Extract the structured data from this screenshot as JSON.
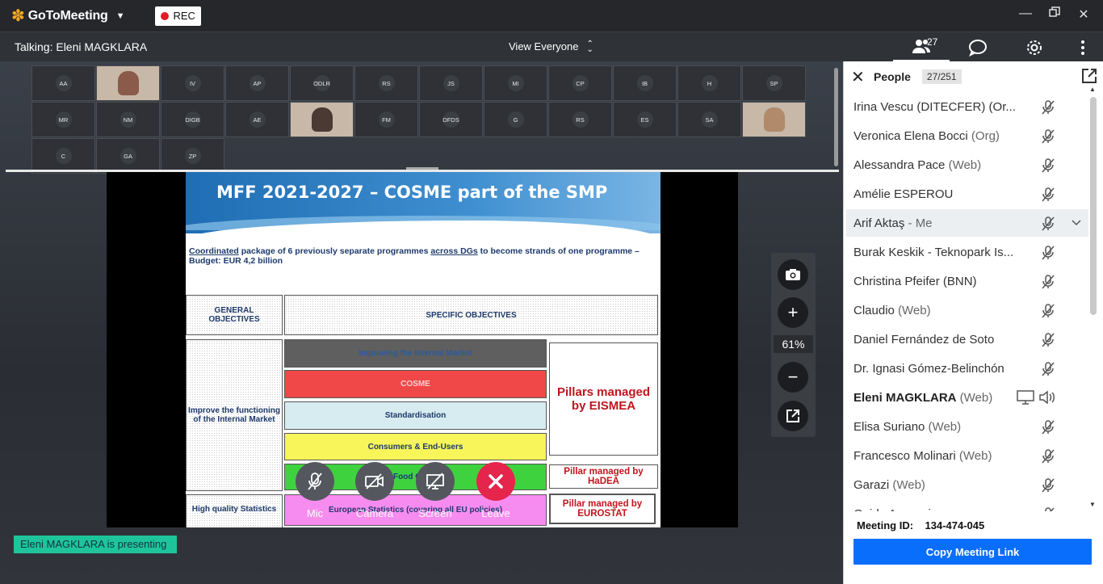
{
  "app": {
    "name": "GoToMeeting",
    "rec_label": "REC",
    "talking": "Talking: Eleni MAGKLARA",
    "view_mode": "View Everyone",
    "participant_count": "27"
  },
  "window_controls": [
    "minimize-icon",
    "restore-icon",
    "close-icon"
  ],
  "thumbnails": [
    {
      "initials": "AA"
    },
    {
      "initials": "",
      "video": true
    },
    {
      "initials": "IV"
    },
    {
      "initials": "AP"
    },
    {
      "initials": "ODLR"
    },
    {
      "initials": "RS"
    },
    {
      "initials": "JS"
    },
    {
      "initials": "MI"
    },
    {
      "initials": "CP"
    },
    {
      "initials": "IB"
    },
    {
      "initials": "H"
    },
    {
      "initials": "SP"
    },
    {
      "initials": "MR"
    },
    {
      "initials": "NM"
    },
    {
      "initials": "DIGB"
    },
    {
      "initials": "AE"
    },
    {
      "initials": "",
      "video": true
    },
    {
      "initials": "FM"
    },
    {
      "initials": "DFDS"
    },
    {
      "initials": "G"
    },
    {
      "initials": "RS"
    },
    {
      "initials": "ES"
    },
    {
      "initials": "SA"
    },
    {
      "initials": "",
      "video": true
    },
    {
      "initials": "C"
    },
    {
      "initials": "GA"
    },
    {
      "initials": "ZP"
    }
  ],
  "slide": {
    "title": "MFF 2021-2027 – COSME part of the SMP",
    "sub_1": "Coordinated",
    "sub_2": " package of 6 previously separate  programmes ",
    "sub_3": "across DGs",
    "sub_4": " to become strands of one programme – Budget: EUR 4,2 billion",
    "general_objectives": "GENERAL OBJECTIVES",
    "specific_objectives": "SPECIFIC OBJECTIVES",
    "improve_functioning": "Improve the functioning of the Internal Market",
    "high_quality": "High quality Statistics",
    "strands": [
      {
        "label": "Improving the Internal Market",
        "bg": "#5f5f5f",
        "fg": "#2b5c9c"
      },
      {
        "label": "COSME",
        "bg": "#f04848",
        "fg": "#f5d0d0"
      },
      {
        "label": "Standardisation",
        "bg": "#d7ecf0",
        "fg": "#1d3a6b"
      },
      {
        "label": "Consumers & End-Users",
        "bg": "#f7f55a",
        "fg": "#1d3a6b"
      },
      {
        "label": "Food Chain",
        "bg": "#3fd23f",
        "fg": "#1d3a6b"
      },
      {
        "label": "European Statistics (covering all EU policies)",
        "bg": "#f78cf0",
        "fg": "#1d3a6b"
      }
    ],
    "pillars_eismea": "Pillars managed by EISMEA",
    "pillar_hadea": "Pillar managed by HaDEA",
    "pillar_eurostat": "Pillar managed by EUROSTAT"
  },
  "zoom": {
    "percent": "61%"
  },
  "presenting": "Eleni MAGKLARA is presenting",
  "controls": [
    {
      "label": "Mic"
    },
    {
      "label": "Camera"
    },
    {
      "label": "Screen"
    },
    {
      "label": "Leave"
    }
  ],
  "people": {
    "title": "People",
    "count": "27/251",
    "list": [
      {
        "name": "Irina Vescu (DITECFER) (Or...",
        "suffix": ""
      },
      {
        "name": "Veronica Elena Bocci",
        "suffix": " (Org)"
      },
      {
        "name": "Alessandra Pace",
        "suffix": " (Web)"
      },
      {
        "name": "Amélie ESPEROU",
        "suffix": ""
      },
      {
        "name": "Arif Aktaş",
        "suffix": " - Me"
      },
      {
        "name": "Burak Keskik - Teknopark Is...",
        "suffix": ""
      },
      {
        "name": "Christina Pfeifer (BNN)",
        "suffix": ""
      },
      {
        "name": "Claudio",
        "suffix": " (Web)"
      },
      {
        "name": "Daniel Fernández de Soto",
        "suffix": ""
      },
      {
        "name": "Dr. Ignasi Gómez-Belinchón",
        "suffix": ""
      },
      {
        "name": "Eleni MAGKLARA",
        "suffix": " (Web)"
      },
      {
        "name": "Elisa Suriano",
        "suffix": " (Web)"
      },
      {
        "name": "Francesco Molinari",
        "suffix": " (Web)"
      },
      {
        "name": "Garazi",
        "suffix": " (Web)"
      },
      {
        "name": "Guido Acconcia",
        "suffix": ""
      }
    ],
    "meeting_id_label": "Meeting ID:",
    "meeting_id": "134-474-045",
    "copy_link": "Copy Meeting Link"
  }
}
